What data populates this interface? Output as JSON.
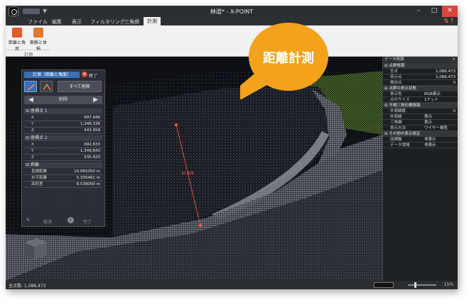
{
  "window": {
    "title": "林道* - X-POINT"
  },
  "titlebar": {
    "qa_symbol": "▼",
    "minimize": "–",
    "maximize": "□",
    "close": "✕"
  },
  "menu": {
    "items": [
      "ファイル",
      "編集",
      "表示",
      "フィルタリング",
      "三角網",
      "計測"
    ],
    "active": "計測",
    "right_icons": "⇅ ?"
  },
  "ribbon": {
    "buttons": [
      {
        "label": "距離と角度",
        "icon": "distance-angle-icon",
        "color": "#e05a2a"
      },
      {
        "label": "面積と体積",
        "icon": "area-volume-icon",
        "color": "#e07a2a"
      }
    ],
    "group_label": "計測"
  },
  "measure_panel": {
    "tab_label": "計測（距離と角度）",
    "end_icon": "✕",
    "end_label": "終了",
    "clear_all": "すべて削除",
    "nav_left": "◀",
    "nav_right": "▶",
    "delete_label": "削除",
    "section_point1": "座標点 1",
    "section_point2": "座標点 2",
    "section_distance": "距離",
    "point1": [
      {
        "key": "X",
        "value": "697.946"
      },
      {
        "key": "Y",
        "value": "1,348.336"
      },
      {
        "key": "Z",
        "value": "543.958"
      }
    ],
    "point2": [
      {
        "key": "X",
        "value": "692.833"
      },
      {
        "key": "Y",
        "value": "1,349.843"
      },
      {
        "key": "Z",
        "value": "535.420"
      }
    ],
    "distance": [
      {
        "key": "直線距離",
        "value": "10.065350 m"
      },
      {
        "key": "水平距離",
        "value": "5.330461 m"
      },
      {
        "key": "高低差",
        "value": "8.538000 m"
      }
    ],
    "footer_left": "取消",
    "footer_right": "完了"
  },
  "measurement_label": "10.065",
  "data_panel": {
    "title": "データ情報",
    "close": "× ",
    "sections": [
      {
        "title": "点群情報",
        "rows": [
          {
            "key": "全点",
            "value": "1,088,473",
            "num": true
          },
          {
            "key": "表示点",
            "value": "1,088,473",
            "num": true
          },
          {
            "key": "無効点",
            "value": "0",
            "num": true
          }
        ]
      },
      {
        "title": "点群の表示状態",
        "rows": [
          {
            "key": "表示色",
            "value": "RGB表示",
            "num": false
          },
          {
            "key": "点のサイズ",
            "value": "1ドット",
            "num": false
          }
        ]
      },
      {
        "title": "不規三角形網情報",
        "rows": [
          {
            "key": "外周線数",
            "value": "0",
            "num": true
          },
          {
            "key": "外周線",
            "value": "表示",
            "num": false
          },
          {
            "key": "三角網",
            "value": "表示",
            "num": false
          },
          {
            "key": "表示方法",
            "value": "ワイヤー単色",
            "num": false
          }
        ]
      },
      {
        "title": "その他の表示設定",
        "rows": [
          {
            "key": "座標軸",
            "value": "非表示",
            "num": false
          },
          {
            "key": "データ領域",
            "value": "非表示",
            "num": false
          }
        ]
      }
    ]
  },
  "statusbar": {
    "point_count": "全点数: 1,088,473",
    "zoom": "15%"
  },
  "callout": {
    "text": "距離計測"
  },
  "colors": {
    "accent_blue": "#3a6fb6",
    "measure_red": "#e0463c",
    "callout_orange": "#f4a11b"
  }
}
